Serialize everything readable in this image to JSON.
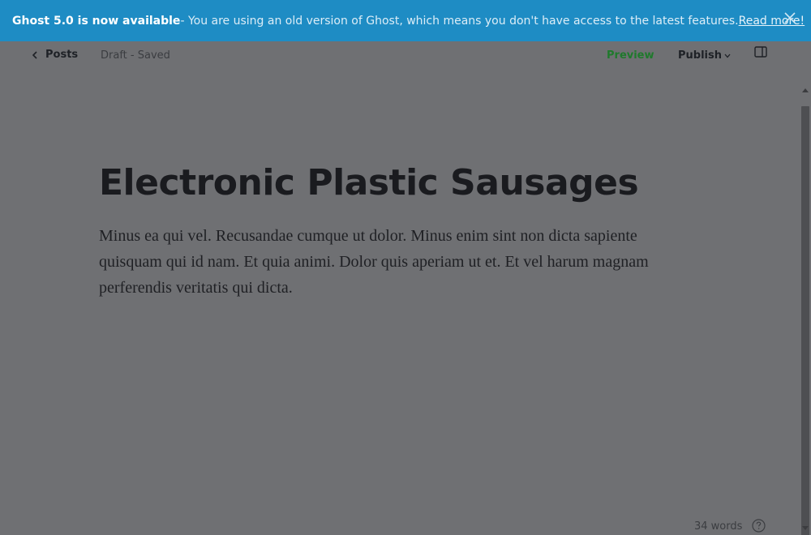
{
  "banner": {
    "strong": "Ghost 5.0 is now available",
    "message": " - You are using an old version of Ghost, which means you don't have access to the latest features. ",
    "link": "Read more!",
    "close_icon": "close-icon"
  },
  "header": {
    "back_label": "Posts",
    "status": "Draft - Saved",
    "preview_label": "Preview",
    "publish_label": "Publish",
    "sidebar_icon": "sidebar-toggle-icon"
  },
  "editor": {
    "title": "Electronic Plastic Sausages",
    "body": "Minus ea qui vel. Recusandae cumque ut dolor. Minus enim sint non dicta sapiente quisquam qui id nam. Et quia animi. Dolor quis aperiam ut et. Et vel harum magnam perferendis veritatis qui dicta."
  },
  "footer": {
    "word_count": "34 words",
    "help_icon": "question-circle-icon"
  },
  "colors": {
    "banner_bg": "#1e8cc4",
    "overlay_bg": "#6f7073",
    "preview_green": "#1f7a2c"
  }
}
